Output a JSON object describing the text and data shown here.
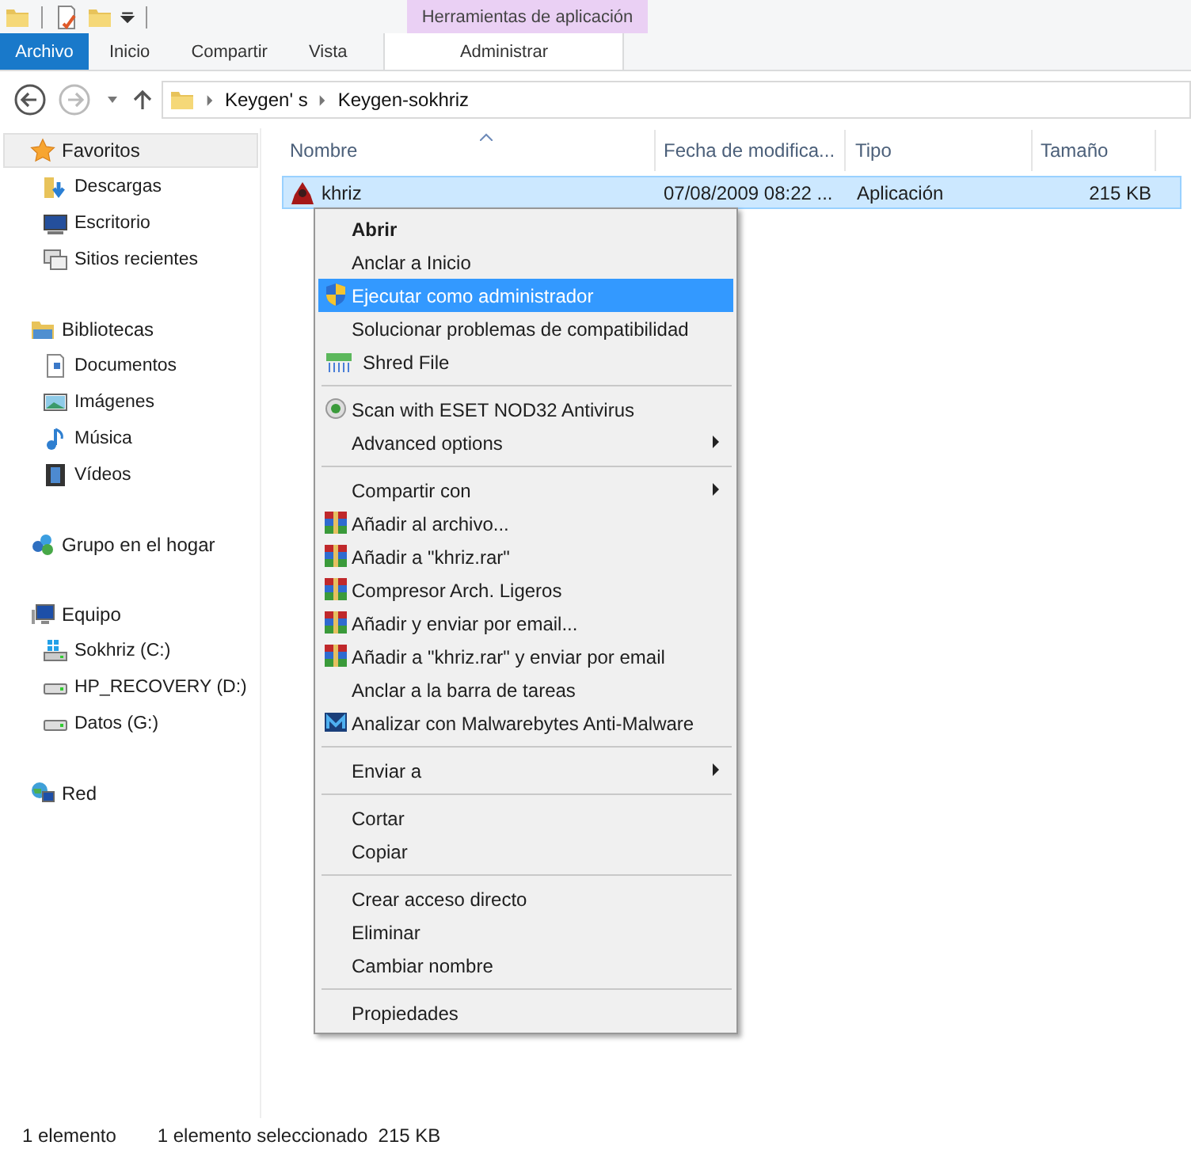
{
  "quick_access": {
    "context_tab": "Herramientas de aplicación"
  },
  "ribbon_tabs": [
    {
      "label": "Archivo",
      "kind": "file"
    },
    {
      "label": "Inicio",
      "kind": "tab"
    },
    {
      "label": "Compartir",
      "kind": "tab"
    },
    {
      "label": "Vista",
      "kind": "tab"
    },
    {
      "label": "Administrar",
      "kind": "context"
    }
  ],
  "breadcrumb": [
    "Keygen' s",
    "Keygen-sokhriz"
  ],
  "sidebar": [
    {
      "label": "Favoritos",
      "kind": "star",
      "selected": true,
      "children": [
        {
          "label": "Descargas",
          "kind": "downloads",
          "selected": false
        },
        {
          "label": "Escritorio",
          "kind": "desktop",
          "selected": false
        },
        {
          "label": "Sitios recientes",
          "kind": "recent",
          "selected": false
        }
      ]
    },
    {
      "label": "Bibliotecas",
      "kind": "library",
      "selected": false,
      "children": [
        {
          "label": "Documentos",
          "kind": "document",
          "selected": false
        },
        {
          "label": "Imágenes",
          "kind": "image",
          "selected": false
        },
        {
          "label": "Música",
          "kind": "music",
          "selected": false
        },
        {
          "label": "Vídeos",
          "kind": "video",
          "selected": false
        }
      ]
    },
    {
      "label": "Grupo en el hogar",
      "kind": "homegroup",
      "selected": false
    },
    {
      "label": "Equipo",
      "kind": "computer",
      "selected": false,
      "children": [
        {
          "label": "Sokhriz (C:)",
          "kind": "system-drive",
          "selected": false
        },
        {
          "label": "HP_RECOVERY (D:)",
          "kind": "drive",
          "selected": false
        },
        {
          "label": "Datos (G:)",
          "kind": "drive",
          "selected": false
        }
      ]
    },
    {
      "label": "Red",
      "kind": "network",
      "selected": false
    }
  ],
  "table": {
    "columns": [
      "Nombre",
      "Fecha de modifica...",
      "Tipo",
      "Tamaño"
    ],
    "rows": [
      {
        "name": "khriz",
        "date": "07/08/2009 08:22 ...",
        "type": "Aplicación",
        "size": "215 KB",
        "selected": true
      }
    ]
  },
  "context_menu": [
    {
      "kind": "plain",
      "label": "Abrir",
      "default": true,
      "selected": false,
      "submenu": false
    },
    {
      "kind": "plain",
      "label": "Anclar a Inicio",
      "default": false,
      "selected": false,
      "submenu": false
    },
    {
      "kind": "shield",
      "label": "Ejecutar como administrador",
      "default": false,
      "selected": true,
      "submenu": false
    },
    {
      "kind": "plain",
      "label": "Solucionar problemas de compatibilidad",
      "default": false,
      "selected": false,
      "submenu": false
    },
    {
      "kind": "shredder",
      "label": "Shred File",
      "default": false,
      "selected": false,
      "submenu": false
    },
    {
      "kind": "separator"
    },
    {
      "kind": "eye",
      "label": "Scan with ESET NOD32 Antivirus",
      "default": false,
      "selected": false,
      "submenu": false
    },
    {
      "kind": "plain",
      "label": "Advanced options",
      "default": false,
      "selected": false,
      "submenu": true
    },
    {
      "kind": "separator"
    },
    {
      "kind": "plain",
      "label": "Compartir con",
      "default": false,
      "selected": false,
      "submenu": true
    },
    {
      "kind": "archive",
      "label": "Añadir al archivo...",
      "default": false,
      "selected": false,
      "submenu": false
    },
    {
      "kind": "archive",
      "label": "Añadir a \"khriz.rar\"",
      "default": false,
      "selected": false,
      "submenu": false
    },
    {
      "kind": "archive",
      "label": "Compresor Arch. Ligeros",
      "default": false,
      "selected": false,
      "submenu": false
    },
    {
      "kind": "archive",
      "label": "Añadir y enviar por email...",
      "default": false,
      "selected": false,
      "submenu": false
    },
    {
      "kind": "archive",
      "label": "Añadir a \"khriz.rar\" y enviar por email",
      "default": false,
      "selected": false,
      "submenu": false
    },
    {
      "kind": "plain",
      "label": "Anclar a la barra de tareas",
      "default": false,
      "selected": false,
      "submenu": false
    },
    {
      "kind": "m-logo",
      "label": "Analizar con Malwarebytes Anti-Malware",
      "default": false,
      "selected": false,
      "submenu": false
    },
    {
      "kind": "separator"
    },
    {
      "kind": "plain",
      "label": "Enviar a",
      "default": false,
      "selected": false,
      "submenu": true
    },
    {
      "kind": "separator"
    },
    {
      "kind": "plain",
      "label": "Cortar",
      "default": false,
      "selected": false,
      "submenu": false
    },
    {
      "kind": "plain",
      "label": "Copiar",
      "default": false,
      "selected": false,
      "submenu": false
    },
    {
      "kind": "separator"
    },
    {
      "kind": "plain",
      "label": "Crear acceso directo",
      "default": false,
      "selected": false,
      "submenu": false
    },
    {
      "kind": "plain",
      "label": "Eliminar",
      "default": false,
      "selected": false,
      "submenu": false
    },
    {
      "kind": "plain",
      "label": "Cambiar nombre",
      "default": false,
      "selected": false,
      "submenu": false
    },
    {
      "kind": "separator"
    },
    {
      "kind": "plain",
      "label": "Propiedades",
      "default": false,
      "selected": false,
      "submenu": false
    }
  ],
  "status_bar": [
    "1 elemento",
    "1 elemento seleccionado  215 KB"
  ]
}
